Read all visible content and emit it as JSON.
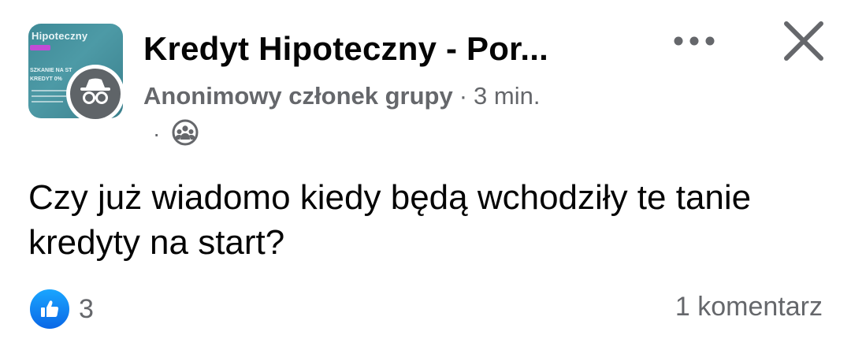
{
  "group": {
    "thumbnail_title": "Hipoteczny",
    "thumbnail_line1": "SZKANIE NA ST",
    "thumbnail_line2": "KREDYT 0%"
  },
  "post": {
    "group_name": "Kredyt Hipoteczny - Por...",
    "author": "Anonimowy członek grupy",
    "separator": "·",
    "time": "3 min.",
    "privacy_separator": "·",
    "privacy_icon": "group-members-icon",
    "text": "Czy już wiadomo kiedy będą wchodziły te tanie kredyty na start?"
  },
  "footer": {
    "reaction_icon": "like-icon",
    "reaction_count": "3",
    "comments": "1 komentarz"
  },
  "actions": {
    "more_icon": "more-options-icon",
    "close_icon": "close-icon"
  },
  "colors": {
    "like_blue": "#0866ff",
    "secondary_text": "#65676b",
    "primary_text": "#050505",
    "thumb_teal": "#4d9aa6",
    "anon_avatar": "#5f6468"
  }
}
